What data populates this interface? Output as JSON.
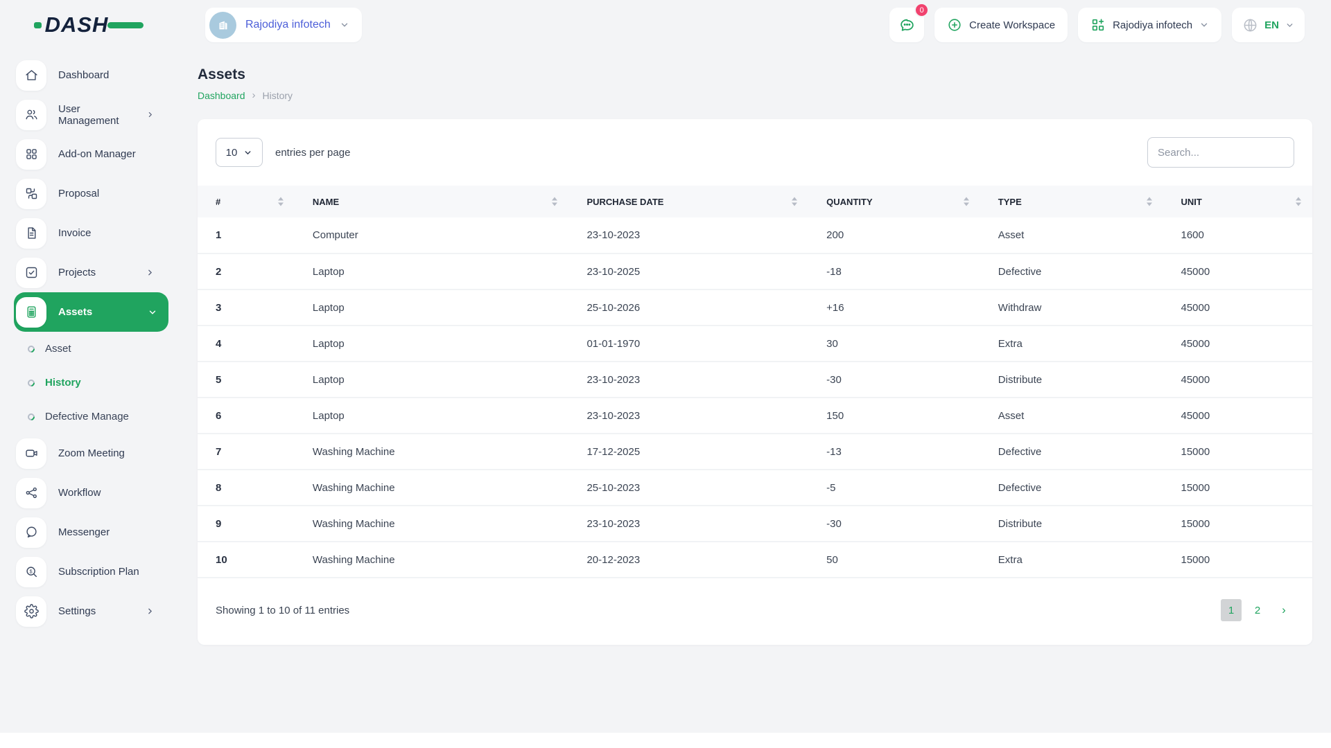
{
  "topbar": {
    "logo_text": "DASH",
    "workspace": {
      "label": "Rajodiya infotech"
    },
    "messages": {
      "badge": "0"
    },
    "create_workspace": {
      "label": "Create Workspace"
    },
    "company_menu": {
      "label": "Rajodiya infotech"
    },
    "language": {
      "label": "EN"
    }
  },
  "sidebar": {
    "items": [
      {
        "label": "Dashboard"
      },
      {
        "label": "User Management"
      },
      {
        "label": "Add-on Manager"
      },
      {
        "label": "Proposal"
      },
      {
        "label": "Invoice"
      },
      {
        "label": "Projects"
      },
      {
        "label": "Assets"
      },
      {
        "label": "Zoom Meeting"
      },
      {
        "label": "Workflow"
      },
      {
        "label": "Messenger"
      },
      {
        "label": "Subscription Plan"
      },
      {
        "label": "Settings"
      }
    ],
    "assets_submenu": [
      {
        "label": "Asset"
      },
      {
        "label": "History",
        "active": true
      },
      {
        "label": "Defective Manage"
      }
    ]
  },
  "page": {
    "title": "Assets",
    "breadcrumb": {
      "root": "Dashboard",
      "separator": "›",
      "current": "History"
    }
  },
  "controls": {
    "page_size": "10",
    "entries_label": "entries per page",
    "search_placeholder": "Search..."
  },
  "table": {
    "columns": [
      "#",
      "NAME",
      "PURCHASE DATE",
      "QUANTITY",
      "TYPE",
      "UNIT"
    ],
    "rows": [
      [
        "1",
        "Computer",
        "23-10-2023",
        "200",
        "Asset",
        "1600"
      ],
      [
        "2",
        "Laptop",
        "23-10-2025",
        "-18",
        "Defective",
        "45000"
      ],
      [
        "3",
        "Laptop",
        "25-10-2026",
        "+16",
        "Withdraw",
        "45000"
      ],
      [
        "4",
        "Laptop",
        "01-01-1970",
        "30",
        "Extra",
        "45000"
      ],
      [
        "5",
        "Laptop",
        "23-10-2023",
        "-30",
        "Distribute",
        "45000"
      ],
      [
        "6",
        "Laptop",
        "23-10-2023",
        "150",
        "Asset",
        "45000"
      ],
      [
        "7",
        "Washing Machine",
        "17-12-2025",
        "-13",
        "Defective",
        "15000"
      ],
      [
        "8",
        "Washing Machine",
        "25-10-2023",
        "-5",
        "Defective",
        "15000"
      ],
      [
        "9",
        "Washing Machine",
        "23-10-2023",
        "-30",
        "Distribute",
        "15000"
      ],
      [
        "10",
        "Washing Machine",
        "20-12-2023",
        "50",
        "Extra",
        "15000"
      ]
    ]
  },
  "table_footer": {
    "showing_text": "Showing 1 to 10 of 11 entries",
    "pages": [
      "1",
      "2"
    ],
    "active_page": "1",
    "next_label": "›"
  },
  "colors": {
    "accent_green": "#20A45F",
    "link_blue": "#4C5ED8",
    "badge_pink": "#F1426E",
    "active_page_bg": "#D2D4D6"
  }
}
